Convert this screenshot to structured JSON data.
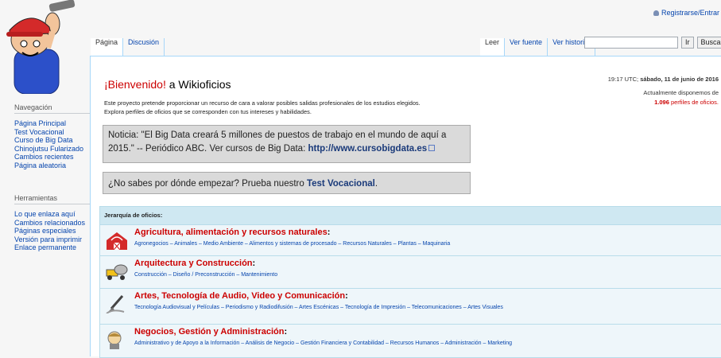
{
  "personal": {
    "login_label": "Registrarse/Entrar"
  },
  "sidebar": {
    "nav_heading": "Navegación",
    "nav_items": [
      "Página Principal",
      "Test Vocacional",
      "Curso de Big Data",
      "Chinojutsu Fularizado",
      "Cambios recientes",
      "Página aleatoria"
    ],
    "tools_heading": "Herramientas",
    "tools_items": [
      "Lo que enlaza aquí",
      "Cambios relacionados",
      "Páginas especiales",
      "Versión para imprimir",
      "Enlace permanente"
    ]
  },
  "tabs": {
    "left": [
      "Página",
      "Discusión"
    ],
    "right": [
      "Leer",
      "Ver fuente",
      "Ver historial"
    ]
  },
  "search": {
    "placeholder": "",
    "go_label": "Ir",
    "search_label": "Buscar"
  },
  "main": {
    "welcome_prefix": "¡Bienvenido!",
    "welcome_suffix": " a Wikioficios",
    "intro_line1": "Este proyecto pretende proporcionar un recurso de cara a valorar posibles salidas profesionales de los estudios elegidos.",
    "intro_line2": "Explora perfiles de oficios que se corresponden con tus intereses y habilidades.",
    "datetime_prefix": "19:17 UTC; ",
    "datetime_bold": "sábado, 11 de junio de 2016",
    "count_label": "Actualmente disponemos de",
    "count_value": "1.096",
    "count_suffix": " perfiles de oficios.",
    "news_text": "Noticia: \"El Big Data creará 5 millones de puestos de trabajo en el mundo de aquí a 2015.\" -- Periódico ABC. Ver cursos de Big Data: ",
    "news_link": "http://www.cursobigdata.es",
    "prompt_text": "¿No sabes por dónde empezar? Prueba nuestro ",
    "prompt_link": "Test Vocacional",
    "prompt_end": "."
  },
  "categories": {
    "header": "Jerarquía de oficios:",
    "items": [
      {
        "title": "Agricultura, alimentación y recursos naturales",
        "icon": "barn-icon",
        "subs": "Agronegocios – Animales – Medio Ambiente – Alimentos y sistemas de procesado – Recursos Naturales – Plantas – Maquinaria"
      },
      {
        "title": "Arquitectura y Construcción",
        "icon": "cement-mixer-icon",
        "subs": "Construcción – Diseño / Preconstrucción – Mantenimiento"
      },
      {
        "title": "Artes, Tecnología de Audio, Video y Comunicación",
        "icon": "brush-icon",
        "subs": "Tecnología Audiovisual y Películas – Periodismo y Radiodifusión – Artes Escénicas – Tecnología de Impresión – Telecomunicaciones – Artes Visuales"
      },
      {
        "title": "Negocios, Gestión y Administración",
        "icon": "businessman-icon",
        "subs": "Administrativo y de Apoyo a la Información – Análisis de Negocio – Gestión Financiera y Contabilidad – Recursos Humanos – Administración – Marketing"
      }
    ]
  },
  "colors": {
    "link": "#0645ad",
    "accent_red": "#cc0000",
    "tab_border": "#a7d7f9",
    "category_bg": "#cfe8f2"
  }
}
